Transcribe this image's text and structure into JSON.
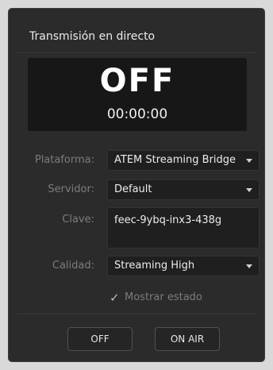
{
  "window": {
    "title": "Transmisión en directo"
  },
  "display": {
    "status": "OFF",
    "timer": "00:00:00"
  },
  "form": {
    "platform": {
      "label": "Plataforma:",
      "value": "ATEM Streaming Bridge"
    },
    "server": {
      "label": "Servidor:",
      "value": "Default"
    },
    "key": {
      "label": "Clave:",
      "value": "feec-9ybq-inx3-438g"
    },
    "quality": {
      "label": "Calidad:",
      "value": "Streaming High"
    },
    "show_status": {
      "label": "Mostrar estado",
      "checked": true
    }
  },
  "buttons": {
    "off_label": "OFF",
    "on_air_label": "ON AIR"
  },
  "icons": {
    "dropdown": "chevron-down-icon",
    "check": "checkmark-icon"
  },
  "colors": {
    "panel_bg": "#2b2b2b",
    "display_bg": "#171717",
    "label_text": "#7c7c7c",
    "field_bg": "#1f1f1f"
  }
}
